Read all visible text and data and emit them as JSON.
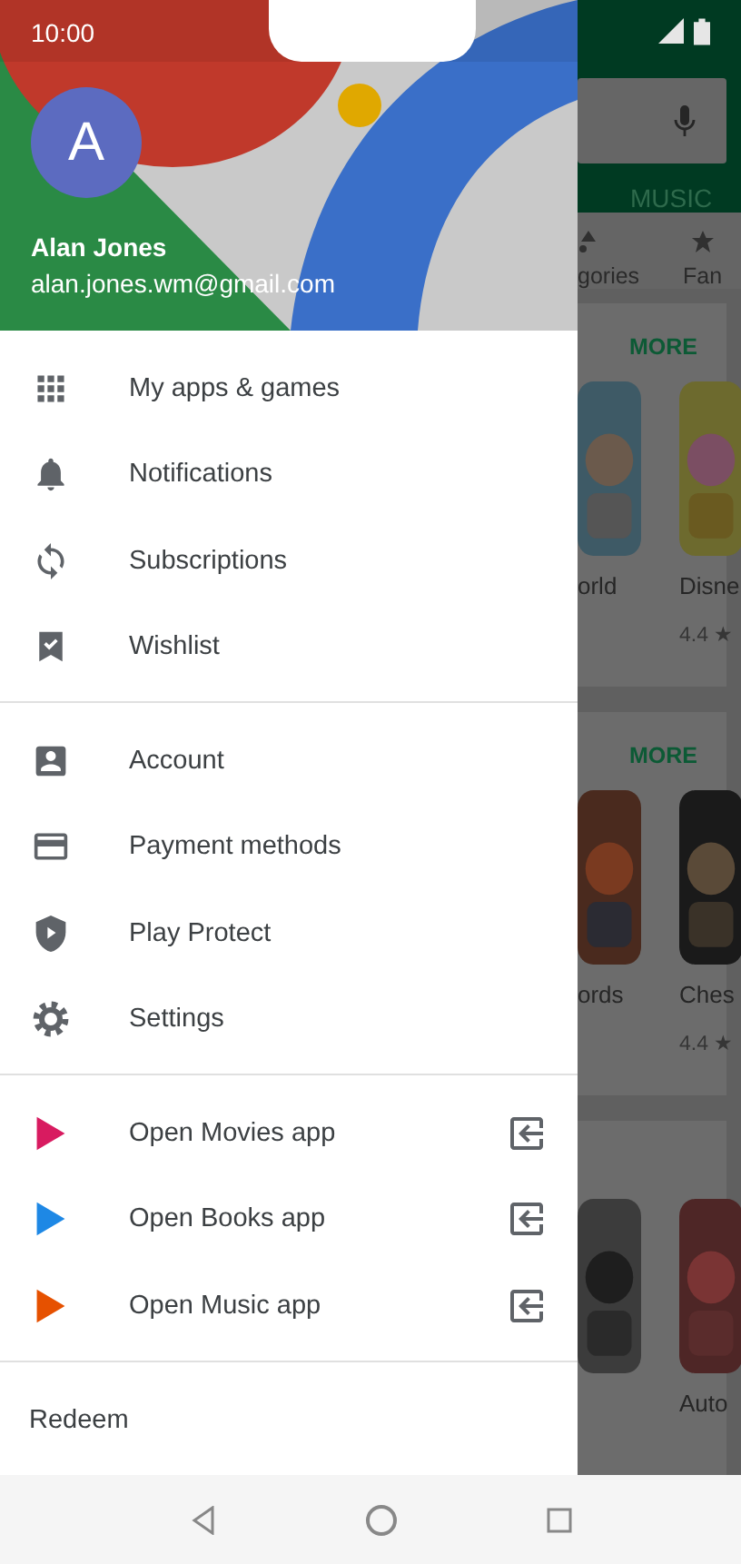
{
  "status_bar": {
    "time": "10:00"
  },
  "account": {
    "avatar_letter": "A",
    "name": "Alan Jones",
    "email": "alan.jones.wm@gmail.com"
  },
  "menu_sections": [
    {
      "items": [
        {
          "label": "My apps & games",
          "kind": "apps"
        },
        {
          "label": "Notifications",
          "kind": "bell"
        },
        {
          "label": "Subscriptions",
          "kind": "sync"
        },
        {
          "label": "Wishlist",
          "kind": "wishlist"
        }
      ]
    },
    {
      "items": [
        {
          "label": "Account",
          "kind": "account"
        },
        {
          "label": "Payment methods",
          "kind": "card"
        },
        {
          "label": "Play Protect",
          "kind": "shield"
        },
        {
          "label": "Settings",
          "kind": "gear"
        }
      ]
    },
    {
      "items": [
        {
          "label": "Open Movies app",
          "kind": "movies",
          "opens_external": true
        },
        {
          "label": "Open Books app",
          "kind": "books",
          "opens_external": true
        },
        {
          "label": "Open Music app",
          "kind": "music",
          "opens_external": true
        }
      ]
    }
  ],
  "footer": {
    "label": "Redeem"
  },
  "background_app": {
    "tab": "MUSIC",
    "categories": [
      "gories",
      "Fan"
    ],
    "cards": [
      {
        "more": "MORE",
        "apps": [
          {
            "title": "orld"
          },
          {
            "title": "Disne",
            "rating": "4.4 ★"
          }
        ]
      },
      {
        "more": "MORE",
        "apps": [
          {
            "title": "ords"
          },
          {
            "title": "Ches",
            "rating": "4.4 ★"
          }
        ]
      },
      {
        "apps": [
          {
            "kind": "picture"
          },
          {
            "title": "Auto"
          }
        ]
      }
    ]
  }
}
